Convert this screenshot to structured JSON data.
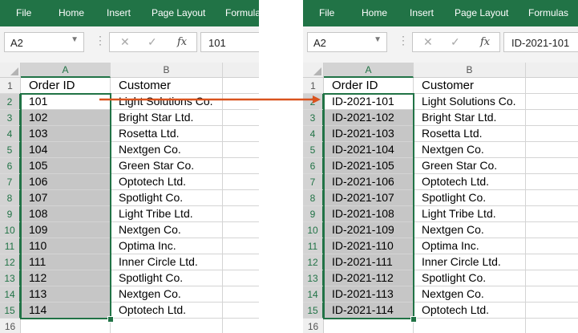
{
  "tabs": [
    "File",
    "Home",
    "Insert",
    "Page Layout",
    "Formulas"
  ],
  "columns": [
    "A",
    "B"
  ],
  "row_numbers": [
    "1",
    "2",
    "3",
    "4",
    "5",
    "6",
    "7",
    "8",
    "9",
    "10",
    "11",
    "12",
    "13",
    "14",
    "15",
    "16"
  ],
  "formula_bar": {
    "fx_label": "fx",
    "dropdown_icon": "chevron-down-icon",
    "cancel_icon": "close-icon",
    "enter_icon": "check-icon"
  },
  "before": {
    "name_box": "A2",
    "formula": "101",
    "header": [
      "Order ID",
      "Customer"
    ],
    "rows": [
      [
        "101",
        "Light Solutions Co."
      ],
      [
        "102",
        "Bright Star Ltd."
      ],
      [
        "103",
        "Rosetta Ltd."
      ],
      [
        "104",
        "Nextgen Co."
      ],
      [
        "105",
        "Green Star Co."
      ],
      [
        "106",
        "Optotech Ltd."
      ],
      [
        "107",
        "Spotlight Co."
      ],
      [
        "108",
        "Light Tribe Ltd."
      ],
      [
        "109",
        "Nextgen Co."
      ],
      [
        "110",
        "Optima Inc."
      ],
      [
        "111",
        "Inner Circle Ltd."
      ],
      [
        "112",
        "Spotlight Co."
      ],
      [
        "113",
        "Nextgen Co."
      ],
      [
        "114",
        "Optotech Ltd."
      ]
    ]
  },
  "after": {
    "name_box": "A2",
    "formula": "ID-2021-101",
    "header": [
      "Order ID",
      "Customer"
    ],
    "rows": [
      [
        "ID-2021-101",
        "Light Solutions Co."
      ],
      [
        "ID-2021-102",
        "Bright Star Ltd."
      ],
      [
        "ID-2021-103",
        "Rosetta Ltd."
      ],
      [
        "ID-2021-104",
        "Nextgen Co."
      ],
      [
        "ID-2021-105",
        "Green Star Co."
      ],
      [
        "ID-2021-106",
        "Optotech Ltd."
      ],
      [
        "ID-2021-107",
        "Spotlight Co."
      ],
      [
        "ID-2021-108",
        "Light Tribe Ltd."
      ],
      [
        "ID-2021-109",
        "Nextgen Co."
      ],
      [
        "ID-2021-110",
        "Optima Inc."
      ],
      [
        "ID-2021-111",
        "Inner Circle Ltd."
      ],
      [
        "ID-2021-112",
        "Spotlight Co."
      ],
      [
        "ID-2021-113",
        "Nextgen Co."
      ],
      [
        "ID-2021-114",
        "Optotech Ltd."
      ]
    ]
  },
  "colors": {
    "accent": "#217346",
    "arrow": "#d9531e",
    "selection_fill": "#c6c6c6"
  }
}
